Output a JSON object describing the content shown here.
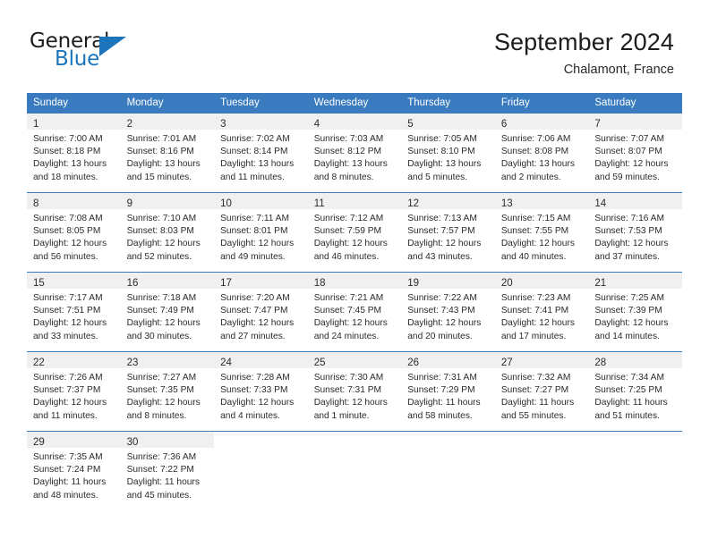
{
  "brand": {
    "name_part1": "General",
    "name_part2": "Blue",
    "accent_color": "#1c75bc",
    "triangle_icon": "triangle-icon"
  },
  "header": {
    "title": "September 2024",
    "location": "Chalamont, France"
  },
  "calendar": {
    "header_bg": "#3a7bc0",
    "daynum_bg": "#f0f0f0",
    "weekday_headers": [
      "Sunday",
      "Monday",
      "Tuesday",
      "Wednesday",
      "Thursday",
      "Friday",
      "Saturday"
    ],
    "weeks": [
      [
        {
          "day": "1",
          "sunrise": "Sunrise: 7:00 AM",
          "sunset": "Sunset: 8:18 PM",
          "daylight1": "Daylight: 13 hours",
          "daylight2": "and 18 minutes."
        },
        {
          "day": "2",
          "sunrise": "Sunrise: 7:01 AM",
          "sunset": "Sunset: 8:16 PM",
          "daylight1": "Daylight: 13 hours",
          "daylight2": "and 15 minutes."
        },
        {
          "day": "3",
          "sunrise": "Sunrise: 7:02 AM",
          "sunset": "Sunset: 8:14 PM",
          "daylight1": "Daylight: 13 hours",
          "daylight2": "and 11 minutes."
        },
        {
          "day": "4",
          "sunrise": "Sunrise: 7:03 AM",
          "sunset": "Sunset: 8:12 PM",
          "daylight1": "Daylight: 13 hours",
          "daylight2": "and 8 minutes."
        },
        {
          "day": "5",
          "sunrise": "Sunrise: 7:05 AM",
          "sunset": "Sunset: 8:10 PM",
          "daylight1": "Daylight: 13 hours",
          "daylight2": "and 5 minutes."
        },
        {
          "day": "6",
          "sunrise": "Sunrise: 7:06 AM",
          "sunset": "Sunset: 8:08 PM",
          "daylight1": "Daylight: 13 hours",
          "daylight2": "and 2 minutes."
        },
        {
          "day": "7",
          "sunrise": "Sunrise: 7:07 AM",
          "sunset": "Sunset: 8:07 PM",
          "daylight1": "Daylight: 12 hours",
          "daylight2": "and 59 minutes."
        }
      ],
      [
        {
          "day": "8",
          "sunrise": "Sunrise: 7:08 AM",
          "sunset": "Sunset: 8:05 PM",
          "daylight1": "Daylight: 12 hours",
          "daylight2": "and 56 minutes."
        },
        {
          "day": "9",
          "sunrise": "Sunrise: 7:10 AM",
          "sunset": "Sunset: 8:03 PM",
          "daylight1": "Daylight: 12 hours",
          "daylight2": "and 52 minutes."
        },
        {
          "day": "10",
          "sunrise": "Sunrise: 7:11 AM",
          "sunset": "Sunset: 8:01 PM",
          "daylight1": "Daylight: 12 hours",
          "daylight2": "and 49 minutes."
        },
        {
          "day": "11",
          "sunrise": "Sunrise: 7:12 AM",
          "sunset": "Sunset: 7:59 PM",
          "daylight1": "Daylight: 12 hours",
          "daylight2": "and 46 minutes."
        },
        {
          "day": "12",
          "sunrise": "Sunrise: 7:13 AM",
          "sunset": "Sunset: 7:57 PM",
          "daylight1": "Daylight: 12 hours",
          "daylight2": "and 43 minutes."
        },
        {
          "day": "13",
          "sunrise": "Sunrise: 7:15 AM",
          "sunset": "Sunset: 7:55 PM",
          "daylight1": "Daylight: 12 hours",
          "daylight2": "and 40 minutes."
        },
        {
          "day": "14",
          "sunrise": "Sunrise: 7:16 AM",
          "sunset": "Sunset: 7:53 PM",
          "daylight1": "Daylight: 12 hours",
          "daylight2": "and 37 minutes."
        }
      ],
      [
        {
          "day": "15",
          "sunrise": "Sunrise: 7:17 AM",
          "sunset": "Sunset: 7:51 PM",
          "daylight1": "Daylight: 12 hours",
          "daylight2": "and 33 minutes."
        },
        {
          "day": "16",
          "sunrise": "Sunrise: 7:18 AM",
          "sunset": "Sunset: 7:49 PM",
          "daylight1": "Daylight: 12 hours",
          "daylight2": "and 30 minutes."
        },
        {
          "day": "17",
          "sunrise": "Sunrise: 7:20 AM",
          "sunset": "Sunset: 7:47 PM",
          "daylight1": "Daylight: 12 hours",
          "daylight2": "and 27 minutes."
        },
        {
          "day": "18",
          "sunrise": "Sunrise: 7:21 AM",
          "sunset": "Sunset: 7:45 PM",
          "daylight1": "Daylight: 12 hours",
          "daylight2": "and 24 minutes."
        },
        {
          "day": "19",
          "sunrise": "Sunrise: 7:22 AM",
          "sunset": "Sunset: 7:43 PM",
          "daylight1": "Daylight: 12 hours",
          "daylight2": "and 20 minutes."
        },
        {
          "day": "20",
          "sunrise": "Sunrise: 7:23 AM",
          "sunset": "Sunset: 7:41 PM",
          "daylight1": "Daylight: 12 hours",
          "daylight2": "and 17 minutes."
        },
        {
          "day": "21",
          "sunrise": "Sunrise: 7:25 AM",
          "sunset": "Sunset: 7:39 PM",
          "daylight1": "Daylight: 12 hours",
          "daylight2": "and 14 minutes."
        }
      ],
      [
        {
          "day": "22",
          "sunrise": "Sunrise: 7:26 AM",
          "sunset": "Sunset: 7:37 PM",
          "daylight1": "Daylight: 12 hours",
          "daylight2": "and 11 minutes."
        },
        {
          "day": "23",
          "sunrise": "Sunrise: 7:27 AM",
          "sunset": "Sunset: 7:35 PM",
          "daylight1": "Daylight: 12 hours",
          "daylight2": "and 8 minutes."
        },
        {
          "day": "24",
          "sunrise": "Sunrise: 7:28 AM",
          "sunset": "Sunset: 7:33 PM",
          "daylight1": "Daylight: 12 hours",
          "daylight2": "and 4 minutes."
        },
        {
          "day": "25",
          "sunrise": "Sunrise: 7:30 AM",
          "sunset": "Sunset: 7:31 PM",
          "daylight1": "Daylight: 12 hours",
          "daylight2": "and 1 minute."
        },
        {
          "day": "26",
          "sunrise": "Sunrise: 7:31 AM",
          "sunset": "Sunset: 7:29 PM",
          "daylight1": "Daylight: 11 hours",
          "daylight2": "and 58 minutes."
        },
        {
          "day": "27",
          "sunrise": "Sunrise: 7:32 AM",
          "sunset": "Sunset: 7:27 PM",
          "daylight1": "Daylight: 11 hours",
          "daylight2": "and 55 minutes."
        },
        {
          "day": "28",
          "sunrise": "Sunrise: 7:34 AM",
          "sunset": "Sunset: 7:25 PM",
          "daylight1": "Daylight: 11 hours",
          "daylight2": "and 51 minutes."
        }
      ],
      [
        {
          "day": "29",
          "sunrise": "Sunrise: 7:35 AM",
          "sunset": "Sunset: 7:24 PM",
          "daylight1": "Daylight: 11 hours",
          "daylight2": "and 48 minutes."
        },
        {
          "day": "30",
          "sunrise": "Sunrise: 7:36 AM",
          "sunset": "Sunset: 7:22 PM",
          "daylight1": "Daylight: 11 hours",
          "daylight2": "and 45 minutes."
        },
        {
          "day": "",
          "sunrise": "",
          "sunset": "",
          "daylight1": "",
          "daylight2": ""
        },
        {
          "day": "",
          "sunrise": "",
          "sunset": "",
          "daylight1": "",
          "daylight2": ""
        },
        {
          "day": "",
          "sunrise": "",
          "sunset": "",
          "daylight1": "",
          "daylight2": ""
        },
        {
          "day": "",
          "sunrise": "",
          "sunset": "",
          "daylight1": "",
          "daylight2": ""
        },
        {
          "day": "",
          "sunrise": "",
          "sunset": "",
          "daylight1": "",
          "daylight2": ""
        }
      ]
    ]
  }
}
